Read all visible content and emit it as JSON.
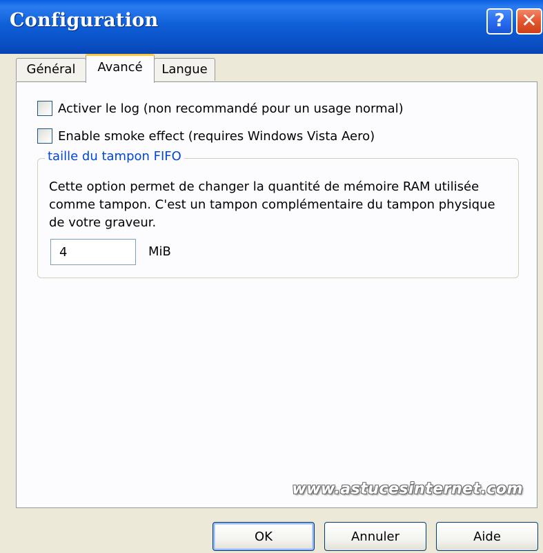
{
  "window": {
    "title": "Configuration",
    "help_glyph": "?",
    "close_glyph": "✕"
  },
  "tabs": [
    {
      "label": "Général",
      "active": false
    },
    {
      "label": "Avancé",
      "active": true
    },
    {
      "label": "Langue",
      "active": false
    }
  ],
  "advanced": {
    "enable_log_label": "Activer le log (non recommandé pour un usage normal)",
    "enable_log_checked": false,
    "smoke_label": "Enable smoke effect (requires Windows Vista Aero)",
    "smoke_checked": false,
    "fifo": {
      "legend": "taille du tampon FIFO",
      "description": "Cette option permet de changer la quantité de mémoire RAM utilisée comme tampon. C'est un tampon complémentaire du tampon physique de votre graveur.",
      "value": "4",
      "unit": "MiB"
    }
  },
  "watermark": "www.astucesinternet.com",
  "buttons": {
    "ok": "OK",
    "cancel": "Annuler",
    "help": "Aide"
  },
  "colors": {
    "titlebar": "#0a4fc4",
    "close": "#e55a32",
    "legend": "#0046d5",
    "tab_highlight": "#ffc83c"
  },
  "icons": {
    "help": "question-mark-icon",
    "close": "close-x-icon"
  }
}
